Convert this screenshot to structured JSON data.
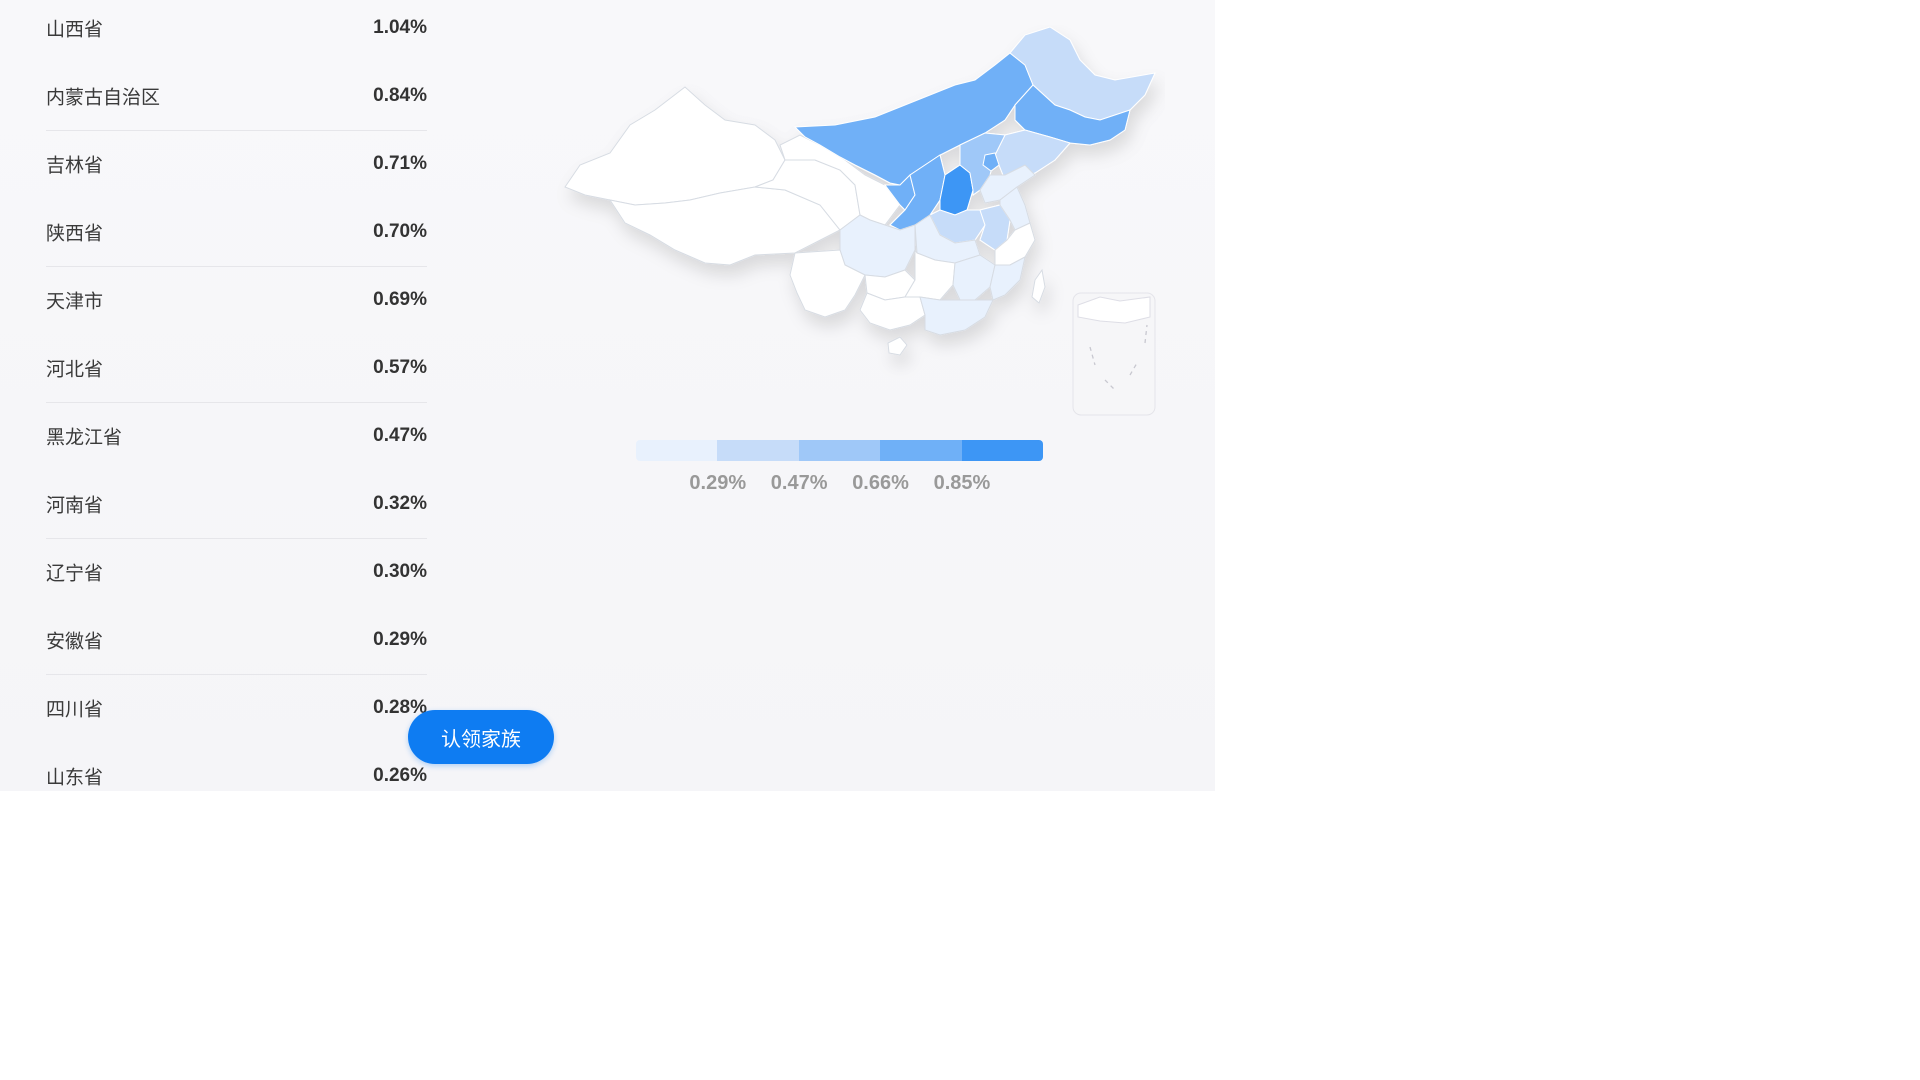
{
  "provinces": [
    {
      "name": "山西省",
      "value": "1.04%"
    },
    {
      "name": "内蒙古自治区",
      "value": "0.84%"
    },
    {
      "name": "吉林省",
      "value": "0.71%"
    },
    {
      "name": "陕西省",
      "value": "0.70%"
    },
    {
      "name": "天津市",
      "value": "0.69%"
    },
    {
      "name": "河北省",
      "value": "0.57%"
    },
    {
      "name": "黑龙江省",
      "value": "0.47%"
    },
    {
      "name": "河南省",
      "value": "0.32%"
    },
    {
      "name": "辽宁省",
      "value": "0.30%"
    },
    {
      "name": "安徽省",
      "value": "0.29%"
    },
    {
      "name": "四川省",
      "value": "0.28%"
    },
    {
      "name": "山东省",
      "value": "0.26%"
    }
  ],
  "legend": {
    "labels": [
      "0.29%",
      "0.47%",
      "0.66%",
      "0.85%"
    ],
    "colors": [
      "#e8f1fd",
      "#c6dcf9",
      "#9fc8f8",
      "#6fb0f7",
      "#3d96f5"
    ]
  },
  "map_colors": {
    "base": "#ffffff",
    "border": "#d7dce3",
    "shadow": "#e3e3e8"
  },
  "claim_button": {
    "label": "认领家族"
  }
}
